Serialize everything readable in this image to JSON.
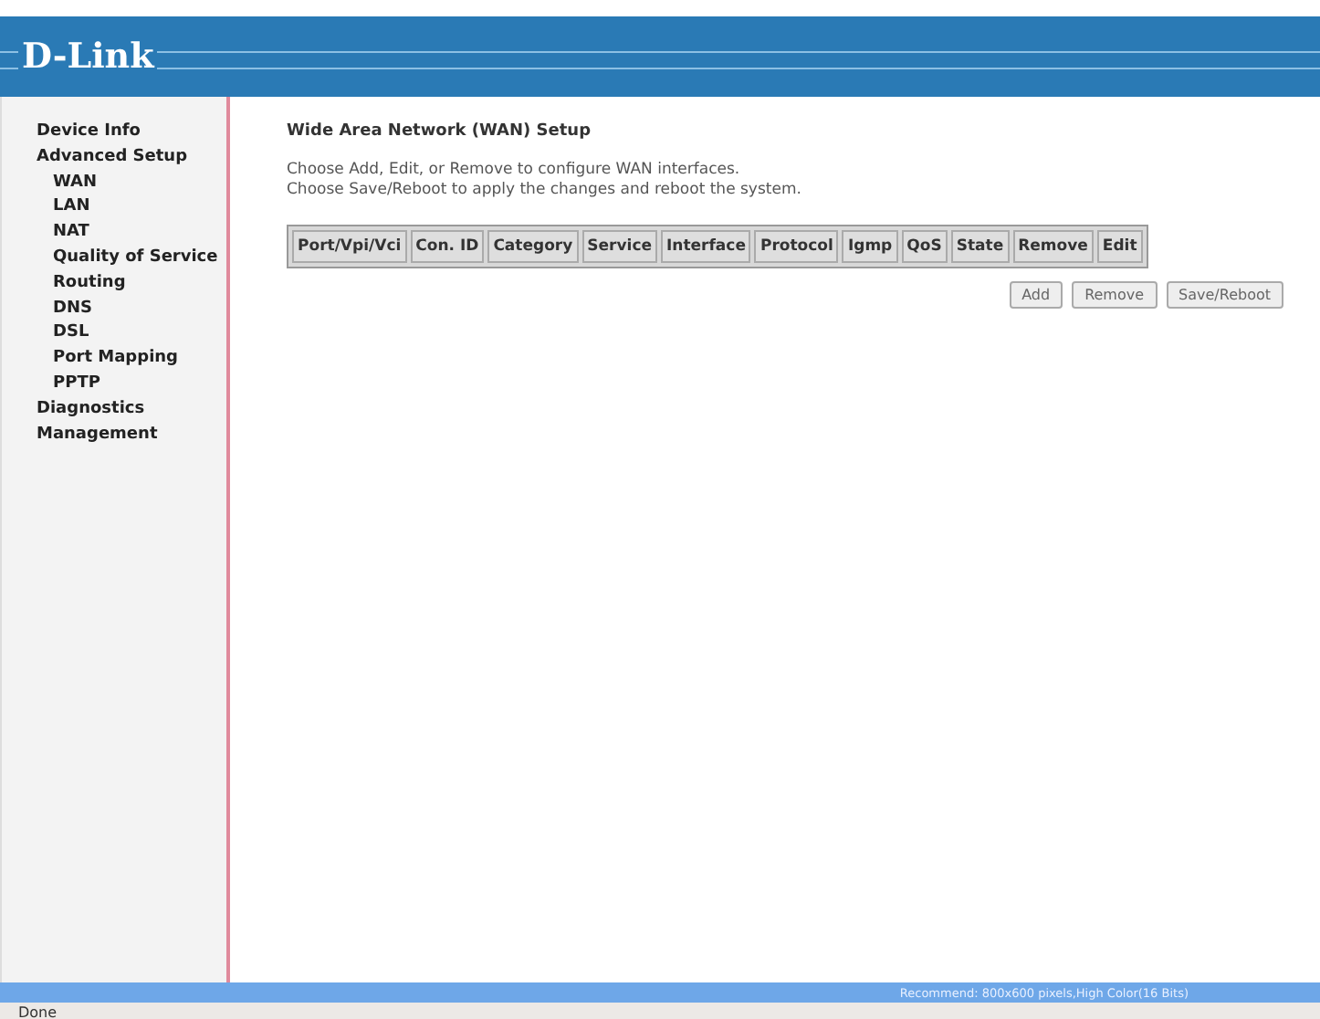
{
  "header": {
    "logo": "D-Link"
  },
  "sidebar": {
    "items": [
      {
        "label": "Device Info"
      },
      {
        "label": "Advanced Setup",
        "children": [
          {
            "label": "WAN"
          },
          {
            "label": "LAN"
          },
          {
            "label": "NAT"
          },
          {
            "label": "Quality of Service"
          },
          {
            "label": "Routing"
          },
          {
            "label": "DNS"
          },
          {
            "label": "DSL"
          },
          {
            "label": "Port Mapping"
          },
          {
            "label": "PPTP"
          }
        ]
      },
      {
        "label": "Diagnostics"
      },
      {
        "label": "Management"
      }
    ]
  },
  "main": {
    "title": "Wide Area Network (WAN) Setup",
    "description": [
      "Choose Add, Edit, or Remove to configure WAN interfaces.",
      "Choose Save/Reboot to apply the changes and reboot the system."
    ],
    "table": {
      "columns": [
        "Port/Vpi/Vci",
        "Con. ID",
        "Category",
        "Service",
        "Interface",
        "Protocol",
        "Igmp",
        "QoS",
        "State",
        "Remove",
        "Edit"
      ]
    },
    "buttons": [
      "Add",
      "Remove",
      "Save/Reboot"
    ]
  },
  "footer": {
    "note": "Recommend: 800x600 pixels,High Color(16 Bits)"
  },
  "status_bar": {
    "text": "Done"
  }
}
